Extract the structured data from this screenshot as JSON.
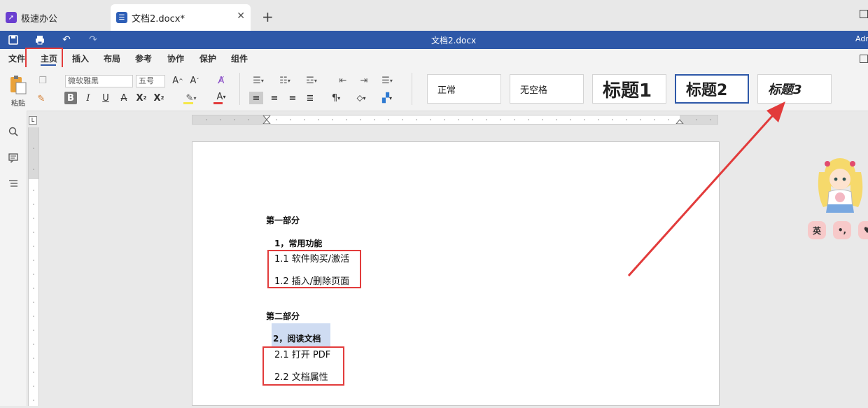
{
  "tabs": [
    {
      "label": "极速办公"
    },
    {
      "label": "文档2.docx*"
    }
  ],
  "titlebar": {
    "title": "文档2.docx",
    "user": "Adm"
  },
  "menu": [
    "文件",
    "主页",
    "插入",
    "布局",
    "参考",
    "协作",
    "保护",
    "组件"
  ],
  "ribbon": {
    "paste_label": "粘贴",
    "font_name": "微软雅黑",
    "font_size": "五号",
    "styles": [
      "正常",
      "无空格",
      "标题1",
      "标题2",
      "标题3"
    ]
  },
  "document": {
    "part1": "第一部分",
    "h1": "1，常用功能",
    "item11": "1.1 软件购买/激活",
    "item12": "1.2 插入/删除页面",
    "part2": "第二部分",
    "h2": "2，阅读文档",
    "item21": "2.1 打开 PDF",
    "item22": "2.2 文档属性"
  },
  "mascot": {
    "badges": [
      "英",
      "•,",
      "♥"
    ]
  },
  "colors": {
    "accent": "#2e58a8",
    "highlight": "#e23b3b"
  }
}
